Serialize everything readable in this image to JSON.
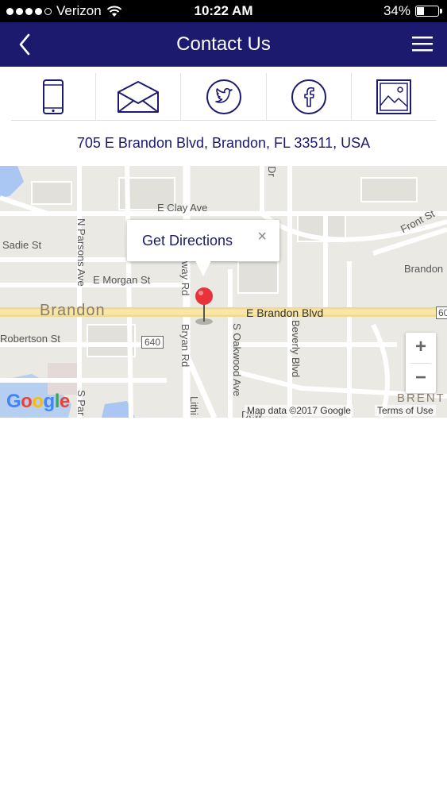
{
  "status_bar": {
    "carrier": "Verizon",
    "time": "10:22 AM",
    "battery_text": "34%",
    "battery_level": 0.34
  },
  "nav": {
    "title": "Contact Us",
    "back_icon": "chevron-left-icon",
    "menu_icon": "hamburger-menu-icon"
  },
  "contact_icons": [
    "phone-icon",
    "email-icon",
    "twitter-icon",
    "facebook-icon",
    "gallery-icon"
  ],
  "address": "705 E Brandon Blvd, Brandon, FL 33511, USA",
  "map": {
    "callout": {
      "text": "Get Directions",
      "close": "×"
    },
    "labels": {
      "e_clay_ave": "E Clay Ave",
      "sadie_st": "Sadie St",
      "n_parsons_ave": "N Parsons Ave",
      "e_morgan_st": "E Morgan St",
      "brandon": "Brandon",
      "e_brandon_blvd": "E Brandon Blvd",
      "robertson_st": "Robertson St",
      "route_640": "640",
      "bryan_rd": "Bryan Rd",
      "way_rd": "way Rd",
      "s_oakwood_ave": "S Oakwood Ave",
      "beverly_blvd": "Beverly Blvd",
      "front_st": "Front St",
      "brandon_right": "Brandon",
      "route_60": "60",
      "brent": "BRENT",
      "s_par": "S Par",
      "lithi": "Lithi",
      "dew": "Dew",
      "dr": "Dr"
    },
    "zoom_in": "+",
    "zoom_out": "−",
    "logo": "Google",
    "map_data": "Map data ©2017 Google",
    "terms": "Terms of Use"
  }
}
